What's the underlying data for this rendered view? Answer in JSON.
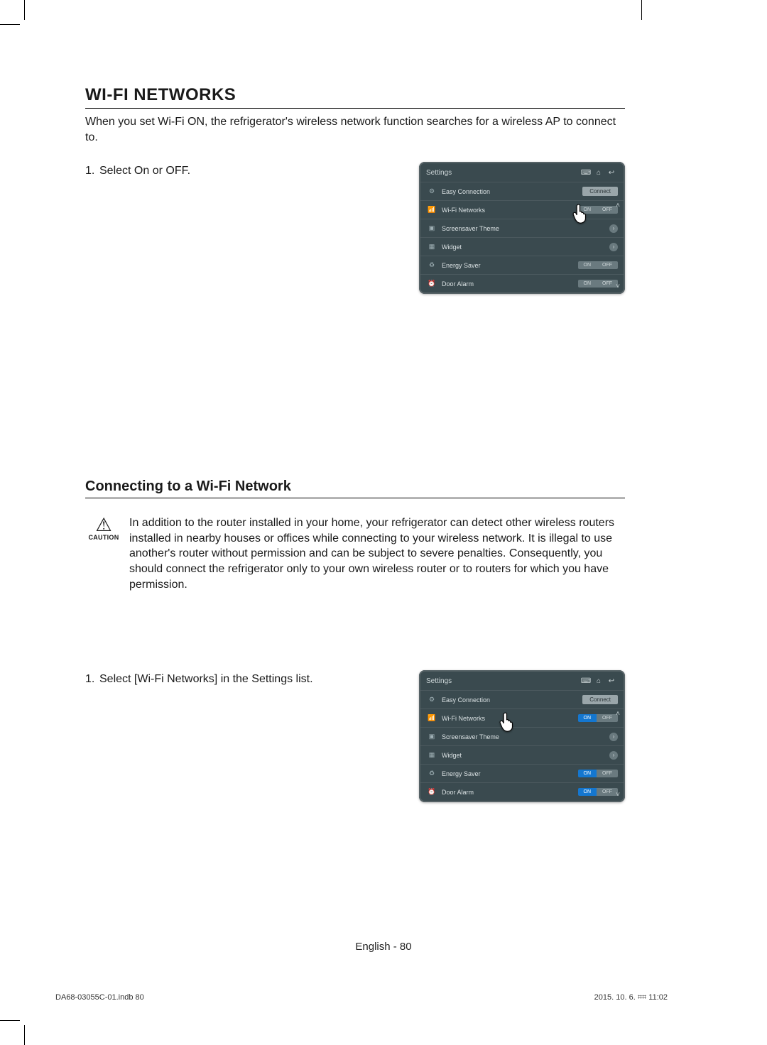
{
  "section_title": "WI-FI NETWORKS",
  "intro": "When you set Wi-Fi ON, the refrigerator's wireless network function searches for a wireless AP to connect to.",
  "step1": {
    "num": "1.",
    "text": "Select On or OFF."
  },
  "subsection_title": "Connecting to a Wi-Fi Network",
  "caution": {
    "label": "CAUTION",
    "text": "In addition to the router installed in your home, your refrigerator can detect other wireless routers installed in nearby houses or offices while connecting to your wireless network. It is illegal to use another's router without permission and can be subject to severe penalties. Consequently, you should connect the refrigerator only to your own wireless router or to routers for which you have permission."
  },
  "step2": {
    "num": "1.",
    "text": "Select [Wi-Fi Networks] in the Settings list."
  },
  "panel": {
    "title": "Settings",
    "rows": {
      "easy": {
        "label": "Easy Connection",
        "btn": "Connect"
      },
      "wifi": {
        "label": "Wi-Fi Networks",
        "on": "ON",
        "off": "OFF"
      },
      "screensaver": {
        "label": "Screensaver Theme"
      },
      "widget": {
        "label": "Widget"
      },
      "energy": {
        "label": "Energy Saver",
        "on": "ON",
        "off": "OFF"
      },
      "door": {
        "label": "Door Alarm",
        "on": "ON",
        "off": "OFF"
      }
    }
  },
  "footer": "English - 80",
  "print": {
    "file": "DA68-03055C-01.indb   80",
    "stamp": "2015. 10. 6.   ⌗⌗ 11:02"
  }
}
